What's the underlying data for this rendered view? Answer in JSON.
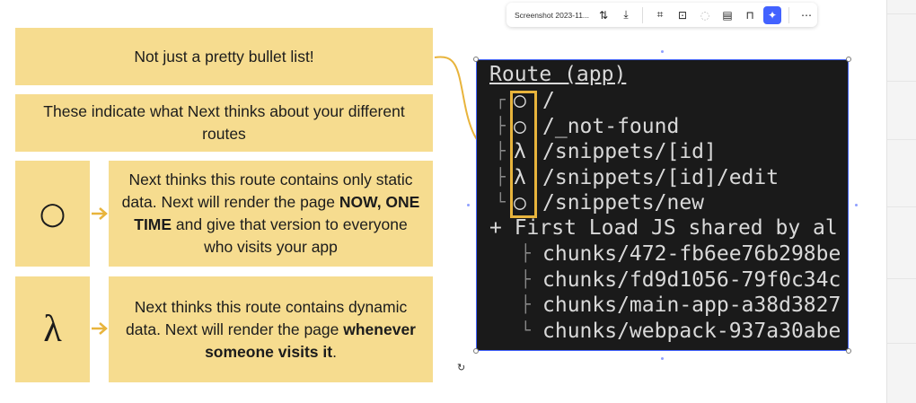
{
  "toolbar": {
    "filename": "Screenshot 2023-11...",
    "icons": [
      "swap-icon",
      "download-icon",
      "crop-icon",
      "fit-icon",
      "loading-icon",
      "comment-icon",
      "lock-icon",
      "ai-icon",
      "more-icon"
    ]
  },
  "boxes": {
    "headline": "Not just a pretty bullet list!",
    "subhead": "These indicate what Next thinks about your different routes",
    "static_symbol": "○",
    "static_text_1": "Next thinks this route contains only static data. Next will render the page ",
    "static_text_bold": "NOW, ONE TIME",
    "static_text_2": " and give that version to everyone who visits your app",
    "dynamic_symbol": "λ",
    "dynamic_text_1": "Next thinks this route contains dynamic data. Next will render the page ",
    "dynamic_text_bold": "whenever someone visits it",
    "dynamic_text_2": "."
  },
  "terminal": {
    "header": "Route (app)",
    "routes": [
      {
        "marker": "○",
        "path": "/"
      },
      {
        "marker": "○",
        "path": "/_not-found"
      },
      {
        "marker": "λ",
        "path": "/snippets/[id]"
      },
      {
        "marker": "λ",
        "path": "/snippets/[id]/edit"
      },
      {
        "marker": "○",
        "path": "/snippets/new"
      }
    ],
    "shared_line": "+ First Load JS shared by al",
    "chunks": [
      "chunks/472-fb6ee76b298be",
      "chunks/fd9d1056-79f0c34c",
      "chunks/main-app-a38d3827",
      "chunks/webpack-937a30abe"
    ]
  },
  "colors": {
    "box": "#f6dc8f",
    "accent": "#e8b43c",
    "terminal_bg": "#1a1a1a",
    "selection": "#4262ff"
  }
}
